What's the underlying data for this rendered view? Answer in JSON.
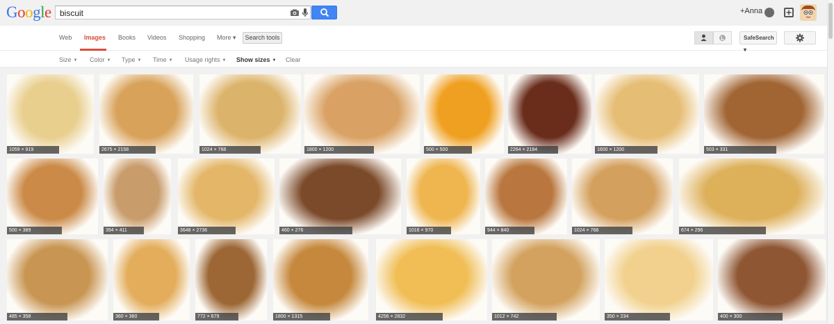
{
  "header": {
    "logo_letters": [
      {
        "ch": "G",
        "color": "#3a77e4"
      },
      {
        "ch": "o",
        "color": "#e03c2f"
      },
      {
        "ch": "o",
        "color": "#f6b500"
      },
      {
        "ch": "g",
        "color": "#3a77e4"
      },
      {
        "ch": "l",
        "color": "#2da44e"
      },
      {
        "ch": "e",
        "color": "#e03c2f"
      }
    ],
    "search_value": "biscuit",
    "user_name": "+Anna",
    "icons": [
      "camera-icon",
      "microphone-icon",
      "magnifier-icon",
      "notifications-icon",
      "share-plus-icon",
      "avatar"
    ]
  },
  "nav": {
    "tabs": [
      "Web",
      "Images",
      "Books",
      "Videos",
      "Shopping",
      "More ▾"
    ],
    "active_tab": "Images",
    "search_tools_label": "Search tools",
    "safesearch_label": "SafeSearch ▾",
    "accent_color": "#dd4b39"
  },
  "tools": {
    "items": [
      "Size",
      "Color",
      "Type",
      "Time",
      "Usage rights",
      "Show sizes",
      "Clear"
    ],
    "bold_item": "Show sizes"
  },
  "results": [
    {
      "dims": "1059 × 919",
      "bg": "#e9cf8e"
    },
    {
      "dims": "2675 × 2158",
      "bg": "#d8a25a"
    },
    {
      "dims": "1024 × 768",
      "bg": "#dcb36a"
    },
    {
      "dims": "1800 × 1200",
      "bg": "#d9a163"
    },
    {
      "dims": "500 × 500",
      "bg": "#f0a020"
    },
    {
      "dims": "2264 × 2184",
      "bg": "#6a2d1c"
    },
    {
      "dims": "1600 × 1200",
      "bg": "#e6bd74"
    },
    {
      "dims": "503 × 331",
      "bg": "#a16534"
    },
    {
      "dims": "500 × 389",
      "bg": "#cb8a48"
    },
    {
      "dims": "394 × 411",
      "bg": "#c99c6c"
    },
    {
      "dims": "3648 × 2736",
      "bg": "#e3b668"
    },
    {
      "dims": "460 × 276",
      "bg": "#7b4a2a"
    },
    {
      "dims": "1016 × 970",
      "bg": "#efb54f"
    },
    {
      "dims": "944 × 840",
      "bg": "#b9773f"
    },
    {
      "dims": "1024 × 768",
      "bg": "#d4a05e"
    },
    {
      "dims": "674 × 296",
      "bg": "#ddb05a"
    },
    {
      "dims": "485 × 358",
      "bg": "#c89552"
    },
    {
      "dims": "360 × 360",
      "bg": "#e3ad5c"
    },
    {
      "dims": "772 × 679",
      "bg": "#9c6735"
    },
    {
      "dims": "1800 × 1315",
      "bg": "#c5883c"
    },
    {
      "dims": "4256 × 2832",
      "bg": "#f0be55"
    },
    {
      "dims": "1012 × 742",
      "bg": "#d3a25f"
    },
    {
      "dims": "350 × 234",
      "bg": "#f1d18d"
    },
    {
      "dims": "400 × 300",
      "bg": "#8e5633"
    }
  ]
}
